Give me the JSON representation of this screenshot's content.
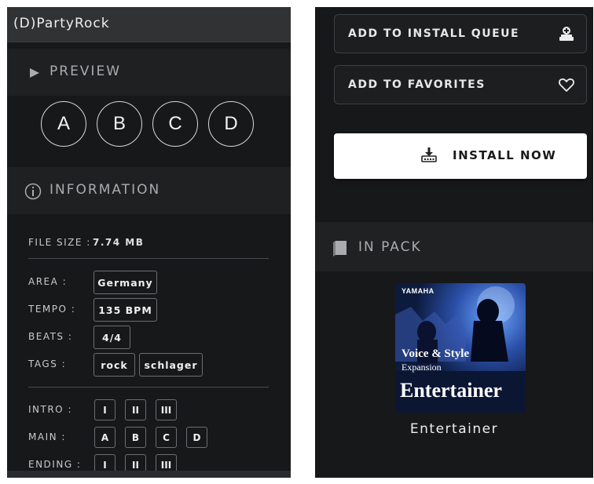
{
  "left": {
    "title": "(D)PartyRock",
    "preview": {
      "label": "PREVIEW",
      "buttons": [
        "A",
        "B",
        "C",
        "D"
      ]
    },
    "information": {
      "label": "INFORMATION",
      "file_size_label": "FILE SIZE :",
      "file_size_value": "7.74 MB",
      "area_label": "AREA :",
      "area_value": "Germany",
      "tempo_label": "TEMPO :",
      "tempo_value": "135 BPM",
      "beats_label": "BEATS :",
      "beats_value": "4/4",
      "tags_label": "TAGS :",
      "tags": [
        "rock",
        "schlager"
      ],
      "intro_label": "INTRO :",
      "intro": [
        "I",
        "II",
        "III"
      ],
      "main_label": "MAIN :",
      "main": [
        "A",
        "B",
        "C",
        "D"
      ],
      "ending_label": "ENDING :",
      "ending": [
        "I",
        "II",
        "III"
      ]
    }
  },
  "right": {
    "install_queue_label": "ADD TO INSTALL QUEUE",
    "favorites_label": "ADD TO FAVORITES",
    "install_now_label": "INSTALL NOW",
    "in_pack_label": "IN PACK",
    "cover": {
      "brand": "YAMAHA",
      "line1": "Voice & Style",
      "line2": "Expansion",
      "title": "Entertainer"
    },
    "pack_name": "Entertainer"
  },
  "icons": {
    "play": "play-icon",
    "info": "info-icon",
    "install_queue": "download-tray-icon",
    "favorite": "heart-icon",
    "install_now": "install-icon",
    "pack": "book-icon"
  },
  "colors": {
    "panel_bg": "#17181a",
    "section_bg": "#1f2022",
    "accent_white": "#ffffff",
    "muted_text": "#a9abae"
  }
}
